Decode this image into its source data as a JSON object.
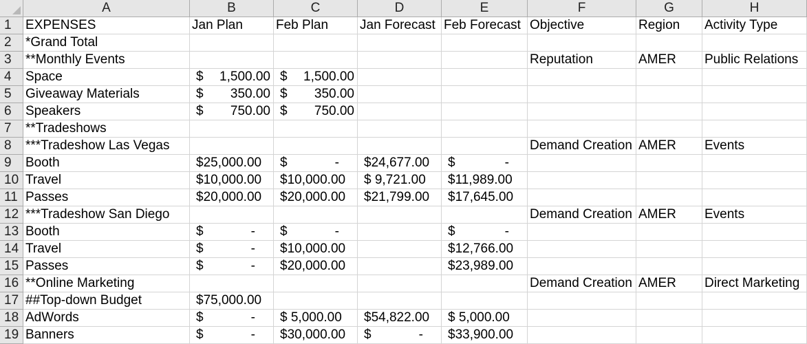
{
  "columns": [
    "A",
    "B",
    "C",
    "D",
    "E",
    "F",
    "G",
    "H"
  ],
  "rows": [
    {
      "num": "1",
      "cells": [
        "EXPENSES",
        "Jan Plan",
        "Feb Plan",
        "Jan Forecast",
        "Feb Forecast",
        "Objective",
        "Region",
        "Activity Type"
      ]
    },
    {
      "num": "2",
      "cells": [
        "*Grand Total",
        "",
        "",
        "",
        "",
        "",
        "",
        ""
      ]
    },
    {
      "num": "3",
      "cells": [
        "**Monthly Events",
        "",
        "",
        "",
        "",
        "Reputation",
        "AMER",
        "Public Relations"
      ]
    },
    {
      "num": "4",
      "cells": [
        "Space",
        "$|1,500.00",
        "$|1,500.00",
        "",
        "",
        "",
        "",
        ""
      ]
    },
    {
      "num": "5",
      "cells": [
        "Giveaway Materials",
        "$|350.00",
        "$|350.00",
        "",
        "",
        "",
        "",
        ""
      ]
    },
    {
      "num": "6",
      "cells": [
        "Speakers",
        "$|750.00",
        "$|750.00",
        "",
        "",
        "",
        "",
        ""
      ]
    },
    {
      "num": "7",
      "cells": [
        "**Tradeshows",
        "",
        "",
        "",
        "",
        "",
        "",
        ""
      ]
    },
    {
      "num": "8",
      "cells": [
        "***Tradeshow Las Vegas",
        "",
        "",
        "",
        "",
        "Demand Creation",
        "AMER",
        "Events"
      ]
    },
    {
      "num": "9",
      "cells": [
        "Booth",
        "$25,000.00",
        "$|-",
        "$24,677.00",
        "$|-",
        "",
        "",
        ""
      ]
    },
    {
      "num": "10",
      "cells": [
        "Travel",
        "$10,000.00",
        "$10,000.00",
        "$ 9,721.00",
        "$11,989.00",
        "",
        "",
        ""
      ]
    },
    {
      "num": "11",
      "cells": [
        "Passes",
        "$20,000.00",
        "$20,000.00",
        "$21,799.00",
        "$17,645.00",
        "",
        "",
        ""
      ]
    },
    {
      "num": "12",
      "cells": [
        "***Tradeshow San Diego",
        "",
        "",
        "",
        "",
        "Demand Creation",
        "AMER",
        "Events"
      ]
    },
    {
      "num": "13",
      "cells": [
        "Booth",
        "$|-",
        "$|-",
        "",
        "$|-",
        "",
        "",
        ""
      ]
    },
    {
      "num": "14",
      "cells": [
        "Travel",
        "$|-",
        "$10,000.00",
        "",
        "$12,766.00",
        "",
        "",
        ""
      ]
    },
    {
      "num": "15",
      "cells": [
        "Passes",
        "$|-",
        "$20,000.00",
        "",
        "$23,989.00",
        "",
        "",
        ""
      ]
    },
    {
      "num": "16",
      "cells": [
        "**Online Marketing",
        "",
        "",
        "",
        "",
        "Demand Creation",
        "AMER",
        "Direct Marketing"
      ]
    },
    {
      "num": "17",
      "cells": [
        "##Top-down Budget",
        "$75,000.00",
        "",
        "",
        "",
        "",
        "",
        ""
      ]
    },
    {
      "num": "18",
      "cells": [
        "AdWords",
        "$|-",
        "$ 5,000.00",
        "$54,822.00",
        "$ 5,000.00",
        "",
        "",
        ""
      ]
    },
    {
      "num": "19",
      "cells": [
        "Banners",
        "$|-",
        "$30,000.00",
        "$|-",
        "$33,900.00",
        "",
        "",
        ""
      ]
    }
  ]
}
